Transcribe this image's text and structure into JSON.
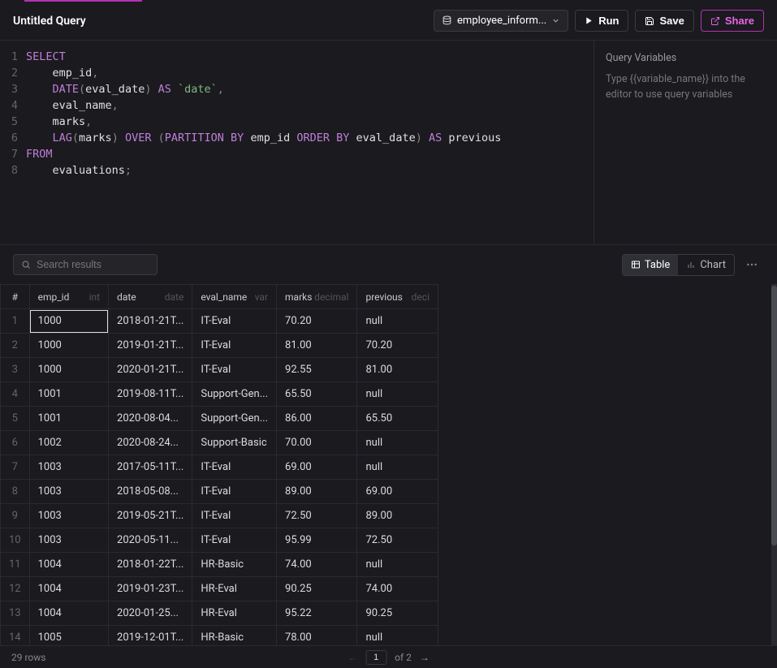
{
  "header": {
    "title": "Untitled Query",
    "database": "employee_inform...",
    "run_label": "Run",
    "save_label": "Save",
    "share_label": "Share"
  },
  "editor": {
    "lines": [
      [
        [
          "kw",
          "SELECT"
        ]
      ],
      [
        [
          "sp",
          "    "
        ],
        [
          "id",
          "emp_id"
        ],
        [
          "pn",
          ","
        ]
      ],
      [
        [
          "sp",
          "    "
        ],
        [
          "fn",
          "DATE"
        ],
        [
          "pn",
          "("
        ],
        [
          "id",
          "eval_date"
        ],
        [
          "pn",
          ")"
        ],
        [
          "sp",
          " "
        ],
        [
          "kw",
          "AS"
        ],
        [
          "sp",
          " "
        ],
        [
          "str",
          "`date`"
        ],
        [
          "pn",
          ","
        ]
      ],
      [
        [
          "sp",
          "    "
        ],
        [
          "id",
          "eval_name"
        ],
        [
          "pn",
          ","
        ]
      ],
      [
        [
          "sp",
          "    "
        ],
        [
          "id",
          "marks"
        ],
        [
          "pn",
          ","
        ]
      ],
      [
        [
          "sp",
          "    "
        ],
        [
          "fn",
          "LAG"
        ],
        [
          "pn",
          "("
        ],
        [
          "id",
          "marks"
        ],
        [
          "pn",
          ")"
        ],
        [
          "sp",
          " "
        ],
        [
          "kw",
          "OVER"
        ],
        [
          "sp",
          " "
        ],
        [
          "pn",
          "("
        ],
        [
          "kw",
          "PARTITION BY"
        ],
        [
          "sp",
          " "
        ],
        [
          "id",
          "emp_id"
        ],
        [
          "sp",
          " "
        ],
        [
          "kw",
          "ORDER BY"
        ],
        [
          "sp",
          " "
        ],
        [
          "id",
          "eval_date"
        ],
        [
          "pn",
          ")"
        ],
        [
          "sp",
          " "
        ],
        [
          "kw",
          "AS"
        ],
        [
          "sp",
          " "
        ],
        [
          "id",
          "previous"
        ]
      ],
      [
        [
          "kw",
          "FROM"
        ]
      ],
      [
        [
          "sp",
          "    "
        ],
        [
          "id",
          "evaluations"
        ],
        [
          "pn",
          ";"
        ]
      ]
    ]
  },
  "variables": {
    "title": "Query Variables",
    "hint": "Type {{variable_name}} into the editor to use query variables"
  },
  "results_toolbar": {
    "search_placeholder": "Search results",
    "table_label": "Table",
    "chart_label": "Chart"
  },
  "columns": [
    {
      "name": "#",
      "type": "",
      "cls": "rownum"
    },
    {
      "name": "emp_id",
      "type": "int",
      "cls": "c-emp"
    },
    {
      "name": "date",
      "type": "date",
      "cls": "c-date"
    },
    {
      "name": "eval_name",
      "type": "var",
      "cls": "c-eval"
    },
    {
      "name": "marks",
      "type": "decimal",
      "cls": "c-marks"
    },
    {
      "name": "previous",
      "type": "deci",
      "cls": "c-prev"
    }
  ],
  "rows": [
    {
      "n": 1,
      "emp_id": "1000",
      "date": "2018-01-21T...",
      "eval_name": "IT-Eval",
      "marks": "70.20",
      "previous": "null",
      "sel": true
    },
    {
      "n": 2,
      "emp_id": "1000",
      "date": "2019-01-21T...",
      "eval_name": "IT-Eval",
      "marks": "81.00",
      "previous": "70.20"
    },
    {
      "n": 3,
      "emp_id": "1000",
      "date": "2020-01-21T...",
      "eval_name": "IT-Eval",
      "marks": "92.55",
      "previous": "81.00"
    },
    {
      "n": 4,
      "emp_id": "1001",
      "date": "2019-08-11T...",
      "eval_name": "Support-Gen...",
      "marks": "65.50",
      "previous": "null"
    },
    {
      "n": 5,
      "emp_id": "1001",
      "date": "2020-08-04...",
      "eval_name": "Support-Gen...",
      "marks": "86.00",
      "previous": "65.50"
    },
    {
      "n": 6,
      "emp_id": "1002",
      "date": "2020-08-24...",
      "eval_name": "Support-Basic",
      "marks": "70.00",
      "previous": "null"
    },
    {
      "n": 7,
      "emp_id": "1003",
      "date": "2017-05-11T...",
      "eval_name": "IT-Eval",
      "marks": "69.00",
      "previous": "null"
    },
    {
      "n": 8,
      "emp_id": "1003",
      "date": "2018-05-08...",
      "eval_name": "IT-Eval",
      "marks": "89.00",
      "previous": "69.00"
    },
    {
      "n": 9,
      "emp_id": "1003",
      "date": "2019-05-21T...",
      "eval_name": "IT-Eval",
      "marks": "72.50",
      "previous": "89.00"
    },
    {
      "n": 10,
      "emp_id": "1003",
      "date": "2020-05-11...",
      "eval_name": "IT-Eval",
      "marks": "95.99",
      "previous": "72.50"
    },
    {
      "n": 11,
      "emp_id": "1004",
      "date": "2018-01-22T...",
      "eval_name": "HR-Basic",
      "marks": "74.00",
      "previous": "null"
    },
    {
      "n": 12,
      "emp_id": "1004",
      "date": "2019-01-23T...",
      "eval_name": "HR-Eval",
      "marks": "90.25",
      "previous": "74.00"
    },
    {
      "n": 13,
      "emp_id": "1004",
      "date": "2020-01-25...",
      "eval_name": "HR-Eval",
      "marks": "95.22",
      "previous": "90.25"
    },
    {
      "n": 14,
      "emp_id": "1005",
      "date": "2019-12-01T...",
      "eval_name": "HR-Basic",
      "marks": "78.00",
      "previous": "null"
    }
  ],
  "footer": {
    "row_count": "29 rows",
    "page": "1",
    "page_of": "of 2"
  }
}
